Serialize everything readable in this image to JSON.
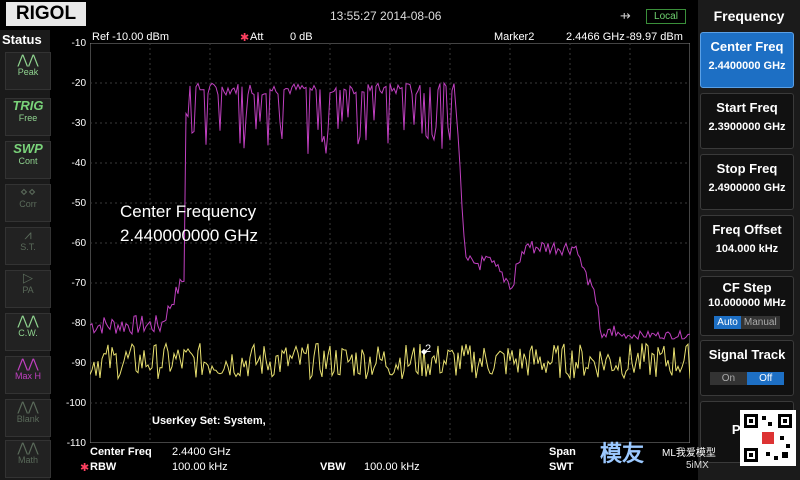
{
  "header": {
    "brand": "RIGOL",
    "datetime": "13:55:27 2014-08-06",
    "usb_icon": "usb-icon",
    "local_label": "Local"
  },
  "status_panel": {
    "title": "Status",
    "items": [
      {
        "icon": "peak-icon",
        "label": "Peak"
      },
      {
        "icon": "trig-icon",
        "title": "TRIG",
        "label": "Free"
      },
      {
        "icon": "swp-icon",
        "title": "SWP",
        "label": "Cont"
      },
      {
        "icon": "corr-icon",
        "label": "Corr"
      },
      {
        "icon": "st-icon",
        "label": "S.T."
      },
      {
        "icon": "pa-icon",
        "label": "PA"
      },
      {
        "icon": "cw-icon",
        "label": "C.W."
      },
      {
        "icon": "maxh-icon",
        "label": "Max H"
      },
      {
        "icon": "blank-icon",
        "label": "Blank"
      },
      {
        "icon": "math-icon",
        "label": "Math"
      }
    ]
  },
  "display": {
    "ref": "Ref -10.00 dBm",
    "att_label": "Att",
    "att_value": "0 dB",
    "marker": "Marker2",
    "marker_freq": "2.4466 GHz",
    "marker_level": "-89.97 dBm",
    "marker2_tag": "2",
    "yticks": [
      "-10",
      "-20",
      "-30",
      "-40",
      "-50",
      "-60",
      "-70",
      "-80",
      "-90",
      "-100",
      "-110"
    ],
    "annotation_line1": "Center Frequency",
    "annotation_line2": "2.440000000 GHz",
    "userkey": "UserKey Set:   System,",
    "bottom": {
      "center_label": "Center Freq",
      "center_value": "2.4400 GHz",
      "rbw_label": "RBW",
      "rbw_value": "100.00 kHz",
      "vbw_label": "VBW",
      "vbw_value": "100.00 kHz",
      "span_label": "Span",
      "swt_label": "SWT"
    },
    "colors": {
      "trace_maxhold": "#c040c0",
      "trace_live": "#e8e070",
      "grid": "#2a2a2a"
    }
  },
  "chart_data": {
    "type": "line",
    "x_range_ghz": [
      2.39,
      2.49
    ],
    "ylim": [
      -110,
      -10
    ],
    "ylabel": "",
    "series": [
      {
        "name": "",
        "color": "#c040c0"
      },
      {
        "name": "",
        "color": "#e8e070"
      }
    ]
  },
  "menu": {
    "title": "Frequency",
    "items": [
      {
        "label": "Center Freq",
        "value": "2.4400000 GHz",
        "selected": true
      },
      {
        "label": "Start Freq",
        "value": "2.3900000 GHz"
      },
      {
        "label": "Stop Freq",
        "value": "2.4900000 GHz"
      },
      {
        "label": "Freq Offset",
        "value": "104.000 kHz"
      },
      {
        "label": "CF Step",
        "value": "10.000000 MHz",
        "seg_a": "Auto",
        "seg_b": "Manual"
      },
      {
        "label": "Signal Track",
        "seg_a": "On",
        "seg_b": "Off"
      },
      {
        "label": "Peak"
      }
    ]
  },
  "watermark": {
    "big": "模友",
    "small1": "ML我爱模型",
    "small2": "5iMX"
  }
}
